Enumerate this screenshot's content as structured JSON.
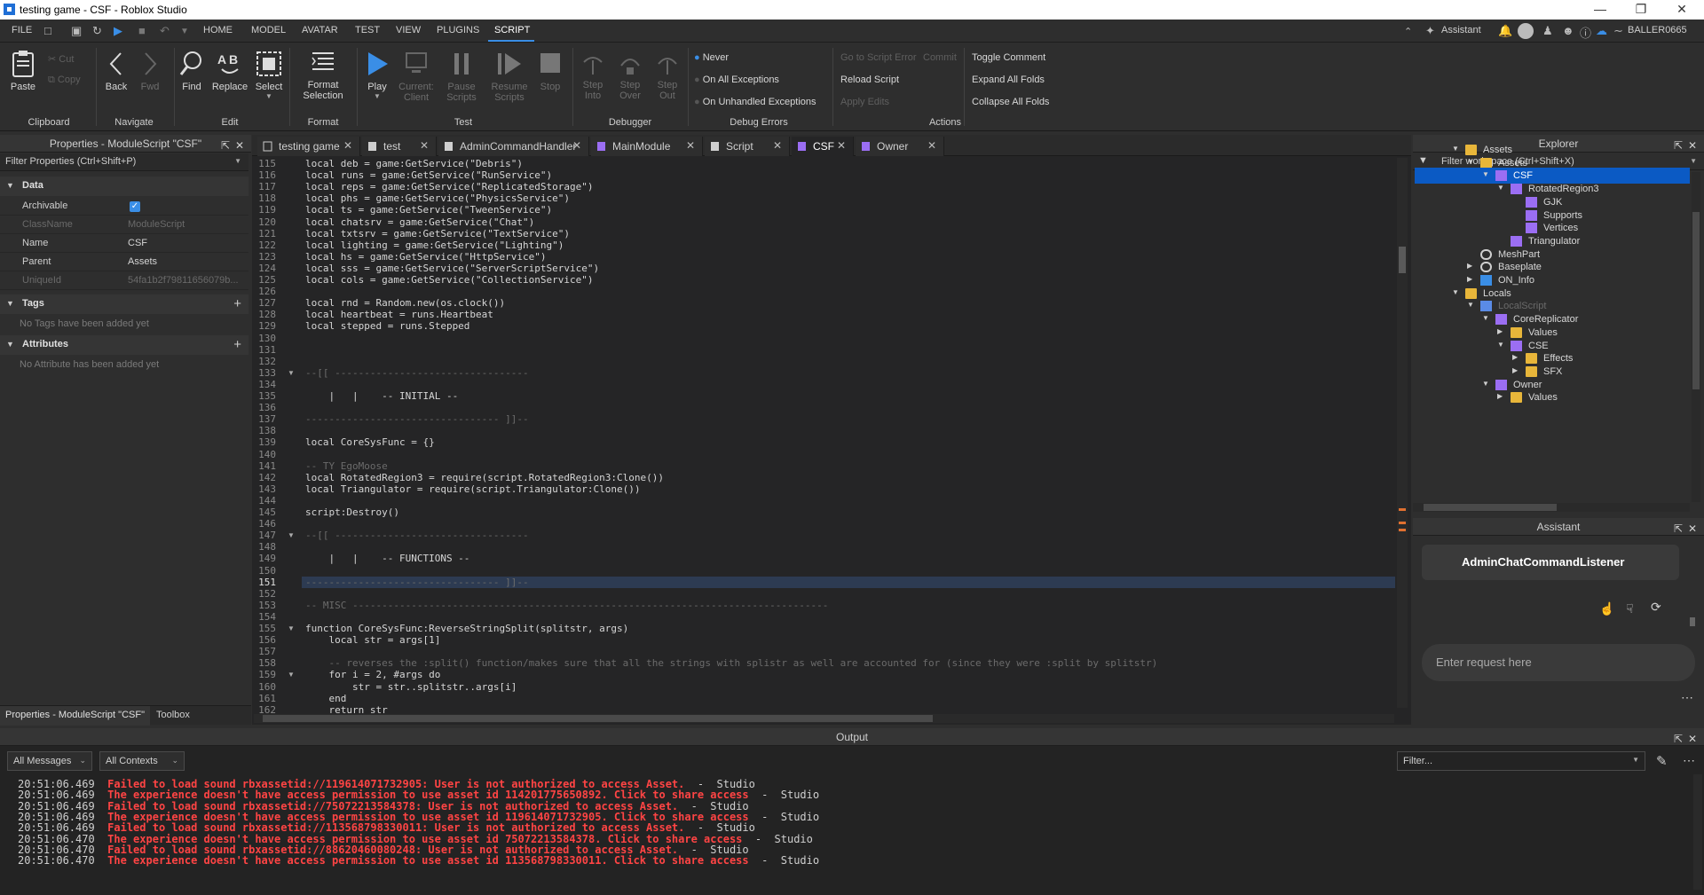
{
  "window": {
    "title": "testing game - CSF - Roblox Studio"
  },
  "menubar": {
    "items": [
      "FILE",
      "HOME",
      "MODEL",
      "AVATAR",
      "TEST",
      "VIEW",
      "PLUGINS",
      "SCRIPT"
    ],
    "active": "SCRIPT",
    "assistant_label": "Assistant",
    "username": "BALLER0665"
  },
  "ribbon": {
    "clipboard": {
      "label": "Clipboard",
      "paste": "Paste",
      "cut": "Cut",
      "copy": "Copy"
    },
    "navigate": {
      "label": "Navigate",
      "back": "Back",
      "fwd": "Fwd"
    },
    "edit": {
      "label": "Edit",
      "find": "Find",
      "replace": "Replace",
      "select": "Select"
    },
    "format": {
      "label": "Format",
      "format_selection_1": "Format",
      "format_selection_2": "Selection"
    },
    "test": {
      "label": "Test",
      "play": "Play",
      "current_1": "Current:",
      "current_2": "Client",
      "pause_1": "Pause",
      "pause_2": "Scripts",
      "resume_1": "Resume",
      "resume_2": "Scripts",
      "stop": "Stop"
    },
    "debugger": {
      "label": "Debugger",
      "step_into_1": "Step",
      "step_into_2": "Into",
      "step_over_1": "Step",
      "step_over_2": "Over",
      "step_out_1": "Step",
      "step_out_2": "Out"
    },
    "debug_errors": {
      "label": "Debug Errors",
      "never": "Never",
      "on_all": "On All Exceptions",
      "on_unhandled": "On Unhandled Exceptions"
    },
    "actions": {
      "label": "Actions",
      "go_to_error": "Go to Script Error",
      "commit": "Commit",
      "reload": "Reload Script",
      "apply_edits": "Apply Edits",
      "toggle_comment": "Toggle Comment",
      "expand_all": "Expand All Folds",
      "collapse_all": "Collapse All Folds"
    }
  },
  "properties": {
    "title": "Properties - ModuleScript \"CSF\"",
    "filter_placeholder": "Filter Properties (Ctrl+Shift+P)",
    "data_section": "Data",
    "rows": [
      {
        "key": "Archivable",
        "value": ""
      },
      {
        "key": "ClassName",
        "value": "ModuleScript"
      },
      {
        "key": "Name",
        "value": "CSF"
      },
      {
        "key": "Parent",
        "value": "Assets"
      },
      {
        "key": "UniqueId",
        "value": "54fa1b2f79811656079b..."
      }
    ],
    "tags_section": "Tags",
    "tags_empty": "No Tags have been added yet",
    "attributes_section": "Attributes",
    "attributes_empty": "No Attribute has been added yet",
    "bottom_tab_1": "Properties - ModuleScript \"CSF\"",
    "bottom_tab_2": "Toolbox"
  },
  "tabs": [
    "testing game",
    "test",
    "AdminCommandHandler",
    "MainModule",
    "Script",
    "CSF",
    "Owner"
  ],
  "active_tab": "CSF",
  "code": {
    "lines": [
      {
        "n": "115",
        "t": "local deb = game:GetService(\"Debris\")"
      },
      {
        "n": "116",
        "t": "local runs = game:GetService(\"RunService\")"
      },
      {
        "n": "117",
        "t": "local reps = game:GetService(\"ReplicatedStorage\")"
      },
      {
        "n": "118",
        "t": "local phs = game:GetService(\"PhysicsService\")"
      },
      {
        "n": "119",
        "t": "local ts = game:GetService(\"TweenService\")"
      },
      {
        "n": "120",
        "t": "local chatsrv = game:GetService(\"Chat\")"
      },
      {
        "n": "121",
        "t": "local txtsrv = game:GetService(\"TextService\")"
      },
      {
        "n": "122",
        "t": "local lighting = game:GetService(\"Lighting\")"
      },
      {
        "n": "123",
        "t": "local hs = game:GetService(\"HttpService\")"
      },
      {
        "n": "124",
        "t": "local sss = game:GetService(\"ServerScriptService\")"
      },
      {
        "n": "125",
        "t": "local cols = game:GetService(\"CollectionService\")"
      },
      {
        "n": "126",
        "t": ""
      },
      {
        "n": "127",
        "t": "local rnd = Random.new(os.clock())"
      },
      {
        "n": "128",
        "t": "local heartbeat = runs.Heartbeat"
      },
      {
        "n": "129",
        "t": "local stepped = runs.Stepped"
      },
      {
        "n": "130",
        "t": ""
      },
      {
        "n": "131",
        "t": ""
      },
      {
        "n": "132",
        "t": ""
      },
      {
        "n": "133",
        "t": "--[[ ---------------------------------"
      },
      {
        "n": "134",
        "t": ""
      },
      {
        "n": "135",
        "t": "    |   |    -- INITIAL --"
      },
      {
        "n": "136",
        "t": ""
      },
      {
        "n": "137",
        "t": "--------------------------------- ]]--"
      },
      {
        "n": "138",
        "t": ""
      },
      {
        "n": "139",
        "t": "local CoreSysFunc = {}"
      },
      {
        "n": "140",
        "t": ""
      },
      {
        "n": "141",
        "t": "-- TY EgoMoose"
      },
      {
        "n": "142",
        "t": "local RotatedRegion3 = require(script.RotatedRegion3:Clone())"
      },
      {
        "n": "143",
        "t": "local Triangulator = require(script.Triangulator:Clone())"
      },
      {
        "n": "144",
        "t": ""
      },
      {
        "n": "145",
        "t": "script:Destroy()"
      },
      {
        "n": "146",
        "t": ""
      },
      {
        "n": "147",
        "t": "--[[ ---------------------------------"
      },
      {
        "n": "148",
        "t": ""
      },
      {
        "n": "149",
        "t": "    |   |    -- FUNCTIONS --"
      },
      {
        "n": "150",
        "t": ""
      },
      {
        "n": "151",
        "t": "--------------------------------- ]]--"
      },
      {
        "n": "152",
        "t": ""
      },
      {
        "n": "153",
        "t": "-- MISC ---------------------------------------------------------------------------------"
      },
      {
        "n": "154",
        "t": ""
      },
      {
        "n": "155",
        "t": "function CoreSysFunc:ReverseStringSplit(splitstr, args)"
      },
      {
        "n": "156",
        "t": "    local str = args[1]"
      },
      {
        "n": "157",
        "t": ""
      },
      {
        "n": "158",
        "t": "    -- reverses the :split() function/makes sure that all the strings with splistr as well are accounted for (since they were :split by splitstr)"
      },
      {
        "n": "159",
        "t": "    for i = 2, #args do"
      },
      {
        "n": "160",
        "t": "        str = str..splitstr..args[i]"
      },
      {
        "n": "161",
        "t": "    end"
      },
      {
        "n": "162",
        "t": "    return str"
      }
    ]
  },
  "explorer": {
    "title": "Explorer",
    "filter_placeholder": "Filter workspace (Ctrl+Shift+X)",
    "items": [
      {
        "name": "Assets",
        "depth": 0,
        "arrow": "open",
        "icon": "folder-icon"
      },
      {
        "name": "Assets",
        "depth": 1,
        "arrow": "open",
        "icon": "folder-icon"
      },
      {
        "name": "CSF",
        "depth": 2,
        "arrow": "open",
        "icon": "modulescript-icon",
        "selected": true
      },
      {
        "name": "RotatedRegion3",
        "depth": 3,
        "arrow": "open",
        "icon": "modulescript-icon"
      },
      {
        "name": "GJK",
        "depth": 4,
        "arrow": "",
        "icon": "modulescript-icon"
      },
      {
        "name": "Supports",
        "depth": 4,
        "arrow": "",
        "icon": "modulescript-icon"
      },
      {
        "name": "Vertices",
        "depth": 4,
        "arrow": "",
        "icon": "modulescript-icon"
      },
      {
        "name": "Triangulator",
        "depth": 3,
        "arrow": "",
        "icon": "modulescript-icon"
      },
      {
        "name": "MeshPart",
        "depth": 1,
        "arrow": "",
        "icon": "meshpart-icon"
      },
      {
        "name": "Baseplate",
        "depth": 1,
        "arrow": "closed",
        "icon": "part-icon"
      },
      {
        "name": "ON_Info",
        "depth": 1,
        "arrow": "closed",
        "icon": "screengui-icon"
      },
      {
        "name": "Locals",
        "depth": 0,
        "arrow": "open",
        "icon": "folder-icon"
      },
      {
        "name": "LocalScript",
        "depth": 1,
        "arrow": "open",
        "icon": "localscript-icon",
        "disabled": true
      },
      {
        "name": "CoreReplicator",
        "depth": 2,
        "arrow": "open",
        "icon": "modulescript-icon"
      },
      {
        "name": "Values",
        "depth": 3,
        "arrow": "closed",
        "icon": "folder-icon"
      },
      {
        "name": "CSE",
        "depth": 3,
        "arrow": "open",
        "icon": "modulescript-icon"
      },
      {
        "name": "Effects",
        "depth": 4,
        "arrow": "closed",
        "icon": "folder-icon"
      },
      {
        "name": "SFX",
        "depth": 4,
        "arrow": "closed",
        "icon": "folder-icon"
      },
      {
        "name": "Owner",
        "depth": 2,
        "arrow": "open",
        "icon": "modulescript-icon"
      },
      {
        "name": "Values",
        "depth": 3,
        "arrow": "closed",
        "icon": "folder-icon"
      }
    ]
  },
  "assistant": {
    "title": "Assistant",
    "card_text": "AdminChatCommandListener",
    "input_placeholder": "Enter request here"
  },
  "output": {
    "title": "Output",
    "filter_messages": "All Messages",
    "filter_contexts": "All Contexts",
    "filter_placeholder": "Filter...",
    "lines": [
      {
        "ts": "20:51:06.469",
        "msg": "Failed to load sound rbxassetid://119614071732905: User is not authorized to access Asset.",
        "src": "  -  Studio"
      },
      {
        "ts": "20:51:06.469",
        "msg": "The experience doesn't have access permission to use asset id 114201775650892. Click to share access",
        "src": "  -  Studio"
      },
      {
        "ts": "20:51:06.469",
        "msg": "Failed to load sound rbxassetid://75072213584378: User is not authorized to access Asset.",
        "src": "  -  Studio"
      },
      {
        "ts": "20:51:06.469",
        "msg": "The experience doesn't have access permission to use asset id 119614071732905. Click to share access",
        "src": "  -  Studio"
      },
      {
        "ts": "20:51:06.469",
        "msg": "Failed to load sound rbxassetid://113568798330011: User is not authorized to access Asset.",
        "src": "  -  Studio"
      },
      {
        "ts": "20:51:06.470",
        "msg": "The experience doesn't have access permission to use asset id 75072213584378. Click to share access",
        "src": "  -  Studio"
      },
      {
        "ts": "20:51:06.470",
        "msg": "Failed to load sound rbxassetid://88620460080248: User is not authorized to access Asset.",
        "src": "  -  Studio"
      },
      {
        "ts": "20:51:06.470",
        "msg": "The experience doesn't have access permission to use asset id 113568798330011. Click to share access",
        "src": "  -  Studio"
      }
    ]
  },
  "colors": {
    "accent": "#0b5ac4",
    "error": "#ff4444",
    "play": "#3a8ee6"
  }
}
